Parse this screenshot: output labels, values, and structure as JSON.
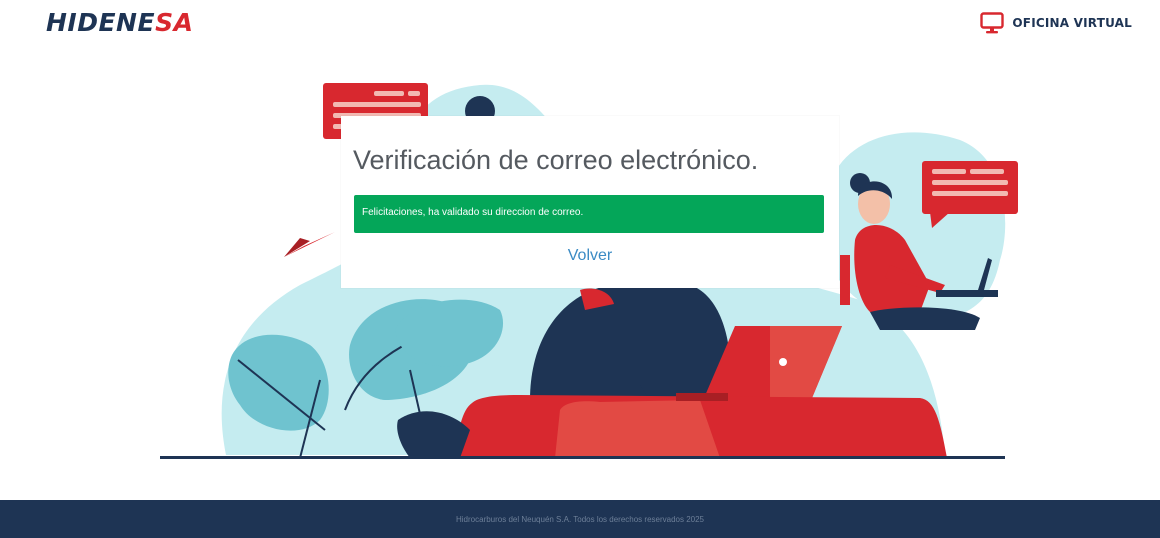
{
  "brand": {
    "part1": "HIDENE",
    "part2": "SA"
  },
  "header": {
    "office_label": "OFICINA VIRTUAL",
    "office_icon": "monitor-icon"
  },
  "card": {
    "title": "Verificación de correo electrónico.",
    "alert_text": "Felicitaciones, ha validado su direccion de correo.",
    "back_label": "Volver"
  },
  "footer": {
    "text": "Hidrocarburos del Neuquén S.A. Todos los derechos reservados 2025"
  },
  "colors": {
    "brand_navy": "#1e3454",
    "brand_red": "#d8282f",
    "success_green": "#04a659",
    "link_blue": "#3b8bc4",
    "illustration_teal": "#c5ecf0"
  }
}
